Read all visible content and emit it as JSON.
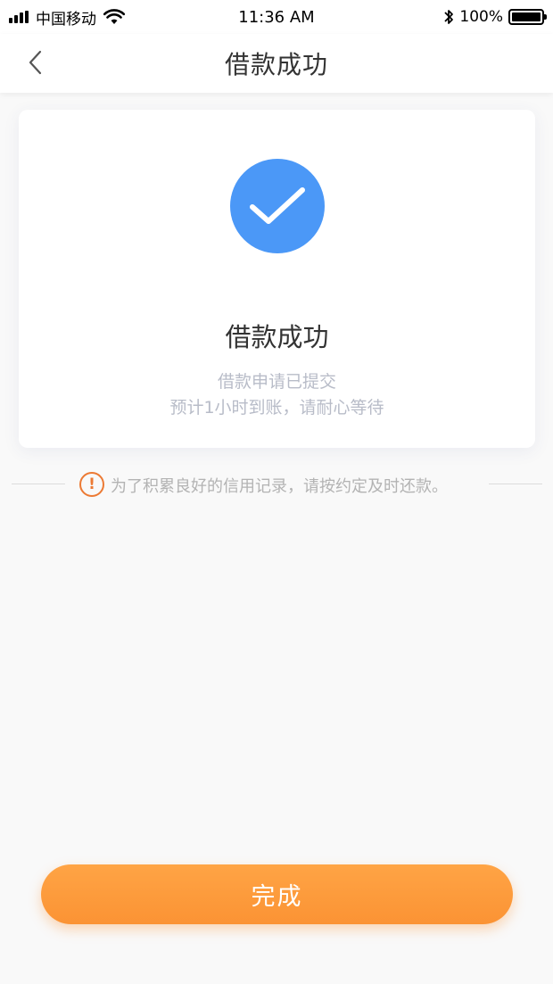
{
  "status_bar": {
    "carrier": "中国移动",
    "time": "11:36 AM",
    "battery_percent": "100%",
    "battery_level": 1.0,
    "icons": [
      "signal-icon",
      "wifi-icon",
      "bluetooth-icon",
      "battery-icon"
    ]
  },
  "nav": {
    "title": "借款成功",
    "back_icon": "chevron-left-icon"
  },
  "result_card": {
    "icon": "checkmark-icon",
    "icon_color": "#4b98f7",
    "title": "借款成功",
    "subtitle_line1": "借款申请已提交",
    "subtitle_line2": "预计1小时到账，请耐心等待"
  },
  "notice": {
    "icon": "warning-icon",
    "icon_color": "#ec7a34",
    "text": "为了积累良好的信用记录，请按约定及时还款。"
  },
  "footer": {
    "done_label": "完成",
    "button_color": "#fb9334"
  }
}
